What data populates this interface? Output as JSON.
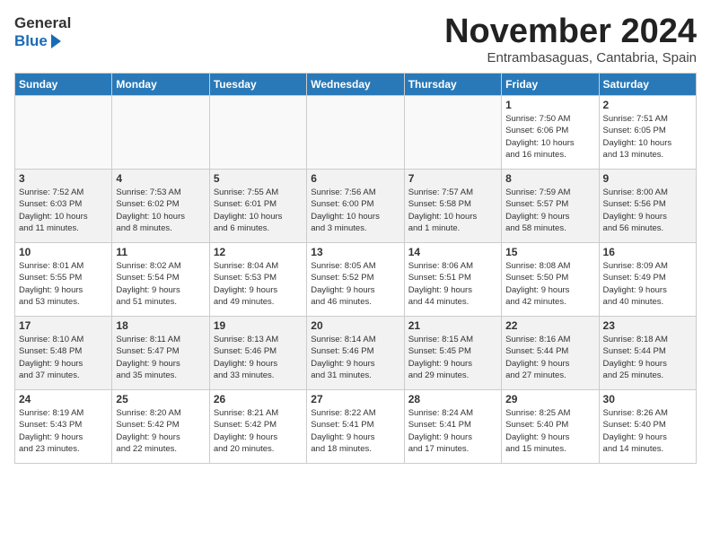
{
  "logo": {
    "line1": "General",
    "line2": "Blue"
  },
  "title": "November 2024",
  "location": "Entrambasaguas, Cantabria, Spain",
  "headers": [
    "Sunday",
    "Monday",
    "Tuesday",
    "Wednesday",
    "Thursday",
    "Friday",
    "Saturday"
  ],
  "weeks": [
    [
      {
        "day": "",
        "detail": ""
      },
      {
        "day": "",
        "detail": ""
      },
      {
        "day": "",
        "detail": ""
      },
      {
        "day": "",
        "detail": ""
      },
      {
        "day": "",
        "detail": ""
      },
      {
        "day": "1",
        "detail": "Sunrise: 7:50 AM\nSunset: 6:06 PM\nDaylight: 10 hours\nand 16 minutes."
      },
      {
        "day": "2",
        "detail": "Sunrise: 7:51 AM\nSunset: 6:05 PM\nDaylight: 10 hours\nand 13 minutes."
      }
    ],
    [
      {
        "day": "3",
        "detail": "Sunrise: 7:52 AM\nSunset: 6:03 PM\nDaylight: 10 hours\nand 11 minutes."
      },
      {
        "day": "4",
        "detail": "Sunrise: 7:53 AM\nSunset: 6:02 PM\nDaylight: 10 hours\nand 8 minutes."
      },
      {
        "day": "5",
        "detail": "Sunrise: 7:55 AM\nSunset: 6:01 PM\nDaylight: 10 hours\nand 6 minutes."
      },
      {
        "day": "6",
        "detail": "Sunrise: 7:56 AM\nSunset: 6:00 PM\nDaylight: 10 hours\nand 3 minutes."
      },
      {
        "day": "7",
        "detail": "Sunrise: 7:57 AM\nSunset: 5:58 PM\nDaylight: 10 hours\nand 1 minute."
      },
      {
        "day": "8",
        "detail": "Sunrise: 7:59 AM\nSunset: 5:57 PM\nDaylight: 9 hours\nand 58 minutes."
      },
      {
        "day": "9",
        "detail": "Sunrise: 8:00 AM\nSunset: 5:56 PM\nDaylight: 9 hours\nand 56 minutes."
      }
    ],
    [
      {
        "day": "10",
        "detail": "Sunrise: 8:01 AM\nSunset: 5:55 PM\nDaylight: 9 hours\nand 53 minutes."
      },
      {
        "day": "11",
        "detail": "Sunrise: 8:02 AM\nSunset: 5:54 PM\nDaylight: 9 hours\nand 51 minutes."
      },
      {
        "day": "12",
        "detail": "Sunrise: 8:04 AM\nSunset: 5:53 PM\nDaylight: 9 hours\nand 49 minutes."
      },
      {
        "day": "13",
        "detail": "Sunrise: 8:05 AM\nSunset: 5:52 PM\nDaylight: 9 hours\nand 46 minutes."
      },
      {
        "day": "14",
        "detail": "Sunrise: 8:06 AM\nSunset: 5:51 PM\nDaylight: 9 hours\nand 44 minutes."
      },
      {
        "day": "15",
        "detail": "Sunrise: 8:08 AM\nSunset: 5:50 PM\nDaylight: 9 hours\nand 42 minutes."
      },
      {
        "day": "16",
        "detail": "Sunrise: 8:09 AM\nSunset: 5:49 PM\nDaylight: 9 hours\nand 40 minutes."
      }
    ],
    [
      {
        "day": "17",
        "detail": "Sunrise: 8:10 AM\nSunset: 5:48 PM\nDaylight: 9 hours\nand 37 minutes."
      },
      {
        "day": "18",
        "detail": "Sunrise: 8:11 AM\nSunset: 5:47 PM\nDaylight: 9 hours\nand 35 minutes."
      },
      {
        "day": "19",
        "detail": "Sunrise: 8:13 AM\nSunset: 5:46 PM\nDaylight: 9 hours\nand 33 minutes."
      },
      {
        "day": "20",
        "detail": "Sunrise: 8:14 AM\nSunset: 5:46 PM\nDaylight: 9 hours\nand 31 minutes."
      },
      {
        "day": "21",
        "detail": "Sunrise: 8:15 AM\nSunset: 5:45 PM\nDaylight: 9 hours\nand 29 minutes."
      },
      {
        "day": "22",
        "detail": "Sunrise: 8:16 AM\nSunset: 5:44 PM\nDaylight: 9 hours\nand 27 minutes."
      },
      {
        "day": "23",
        "detail": "Sunrise: 8:18 AM\nSunset: 5:44 PM\nDaylight: 9 hours\nand 25 minutes."
      }
    ],
    [
      {
        "day": "24",
        "detail": "Sunrise: 8:19 AM\nSunset: 5:43 PM\nDaylight: 9 hours\nand 23 minutes."
      },
      {
        "day": "25",
        "detail": "Sunrise: 8:20 AM\nSunset: 5:42 PM\nDaylight: 9 hours\nand 22 minutes."
      },
      {
        "day": "26",
        "detail": "Sunrise: 8:21 AM\nSunset: 5:42 PM\nDaylight: 9 hours\nand 20 minutes."
      },
      {
        "day": "27",
        "detail": "Sunrise: 8:22 AM\nSunset: 5:41 PM\nDaylight: 9 hours\nand 18 minutes."
      },
      {
        "day": "28",
        "detail": "Sunrise: 8:24 AM\nSunset: 5:41 PM\nDaylight: 9 hours\nand 17 minutes."
      },
      {
        "day": "29",
        "detail": "Sunrise: 8:25 AM\nSunset: 5:40 PM\nDaylight: 9 hours\nand 15 minutes."
      },
      {
        "day": "30",
        "detail": "Sunrise: 8:26 AM\nSunset: 5:40 PM\nDaylight: 9 hours\nand 14 minutes."
      }
    ]
  ]
}
